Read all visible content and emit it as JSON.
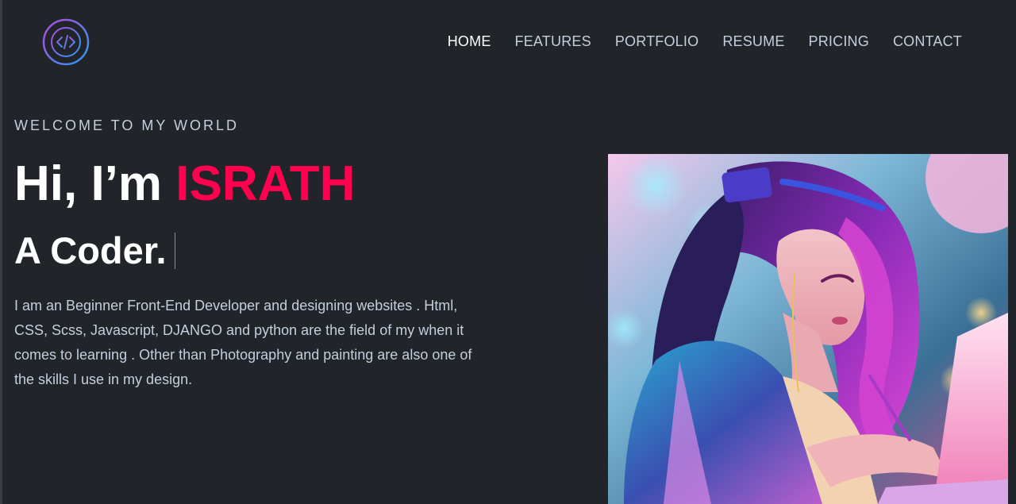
{
  "nav": {
    "items": [
      {
        "label": "HOME",
        "active": true
      },
      {
        "label": "FEATURES",
        "active": false
      },
      {
        "label": "PORTFOLIO",
        "active": false
      },
      {
        "label": "RESUME",
        "active": false
      },
      {
        "label": "PRICING",
        "active": false
      },
      {
        "label": "CONTACT",
        "active": false
      }
    ]
  },
  "hero": {
    "welcome": "WELCOME TO MY WORLD",
    "greeting": "Hi, I’m ",
    "name": "ISRATH",
    "role": "A Coder.",
    "bio": "I am an Beginner Front-End Developer and designing websites . Html, CSS, Scss, Javascript, DJANGO and python are the field of my when it comes to learning . Other than Photography and painting are also one of the skills I use in my design."
  },
  "colors": {
    "background": "#212428",
    "accent": "#ff014f",
    "text": "#c4cfde",
    "heading": "#ffffff"
  },
  "icons": {
    "logo": "code-icon"
  }
}
